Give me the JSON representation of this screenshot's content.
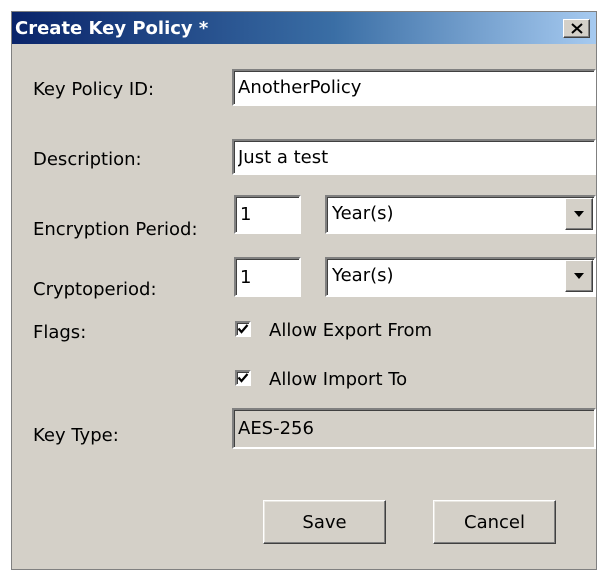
{
  "dialog": {
    "title": "Create Key Policy *"
  },
  "form": {
    "key_policy_id": {
      "label": "Key Policy ID:",
      "value": "AnotherPolicy"
    },
    "description": {
      "label": "Description:",
      "value": "Just a test"
    },
    "encryption_period": {
      "label": "Encryption Period:",
      "number": "1",
      "unit": "Year(s)"
    },
    "cryptoperiod": {
      "label": "Cryptoperiod:",
      "number": "1",
      "unit": "Year(s)"
    },
    "flags": {
      "label": "Flags:",
      "options": [
        {
          "label": "Allow Export From",
          "checked": true
        },
        {
          "label": "Allow Import To",
          "checked": true
        }
      ]
    },
    "key_type": {
      "label": "Key Type:",
      "value": "AES-256"
    }
  },
  "buttons": {
    "save": "Save",
    "cancel": "Cancel"
  },
  "icons": {
    "close": "close-icon",
    "dropdown": "chevron-down-icon",
    "check": "checkmark-icon"
  }
}
